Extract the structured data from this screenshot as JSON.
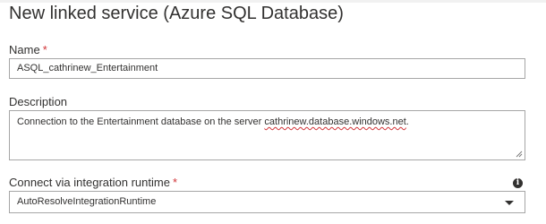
{
  "dialog": {
    "title": "New linked service (Azure SQL Database)"
  },
  "name": {
    "label": "Name",
    "required_marker": "*",
    "value": "ASQL_cathrinew_Entertainment"
  },
  "description": {
    "label": "Description",
    "value_prefix": "Connection to the Entertainment database on the server ",
    "value_server": "cathrinew.database.windows.net",
    "value_suffix": "."
  },
  "integration_runtime": {
    "label": "Connect via integration runtime",
    "required_marker": "*",
    "selected": "AutoResolveIntegrationRuntime",
    "info_icon_glyph": "i"
  },
  "colors": {
    "required": "#d13438",
    "text": "#323130",
    "border": "#a6a6a6"
  },
  "icons": {
    "info": "info-icon",
    "dropdown": "chevron-down-icon",
    "resize": "resize-grip-icon"
  }
}
